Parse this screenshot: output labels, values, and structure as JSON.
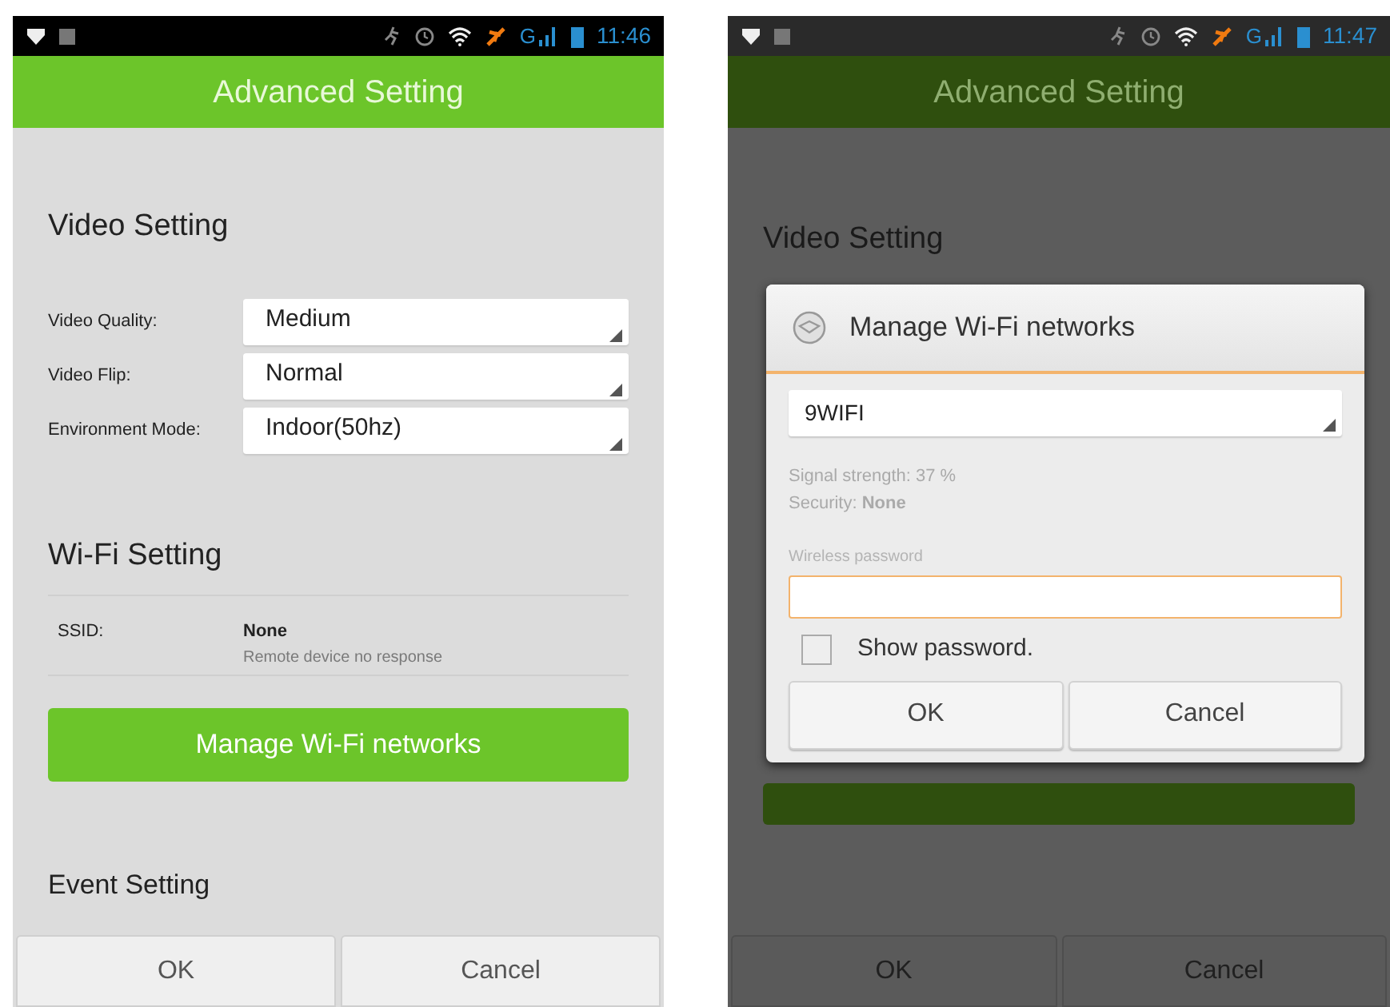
{
  "screens": [
    {
      "status_bar": {
        "network_type": "G",
        "time": "11:46"
      },
      "title": "Advanced Setting",
      "dimmed": false,
      "video_setting": {
        "heading": "Video Setting",
        "fields": [
          {
            "label": "Video Quality:",
            "value": "Medium"
          },
          {
            "label": "Video Flip:",
            "value": "Normal"
          },
          {
            "label": "Environment Mode:",
            "value": "Indoor(50hz)"
          }
        ]
      },
      "wifi_setting": {
        "heading": "Wi-Fi Setting",
        "ssid_label": "SSID:",
        "ssid_value": "None",
        "ssid_note": "Remote device no response",
        "manage_button": "Manage Wi-Fi networks"
      },
      "event_setting": {
        "heading": "Event Setting"
      },
      "buttons": [
        "OK",
        "Cancel"
      ]
    },
    {
      "status_bar": {
        "network_type": "G",
        "time": "11:47"
      },
      "title": "Advanced Setting",
      "dimmed": true,
      "video_setting": {
        "heading": "Video Setting"
      },
      "dialog": {
        "title": "Manage Wi-Fi networks",
        "network": "9WIFI",
        "signal": "Signal strength: 37 %",
        "security": "Security: **None**",
        "password_label": "Wireless password",
        "password_focused": true,
        "show_password": {
          "label": "Show password.",
          "checked": false
        },
        "buttons": [
          "OK",
          "Cancel"
        ]
      },
      "buttons": [
        "OK",
        "Cancel"
      ]
    }
  ]
}
